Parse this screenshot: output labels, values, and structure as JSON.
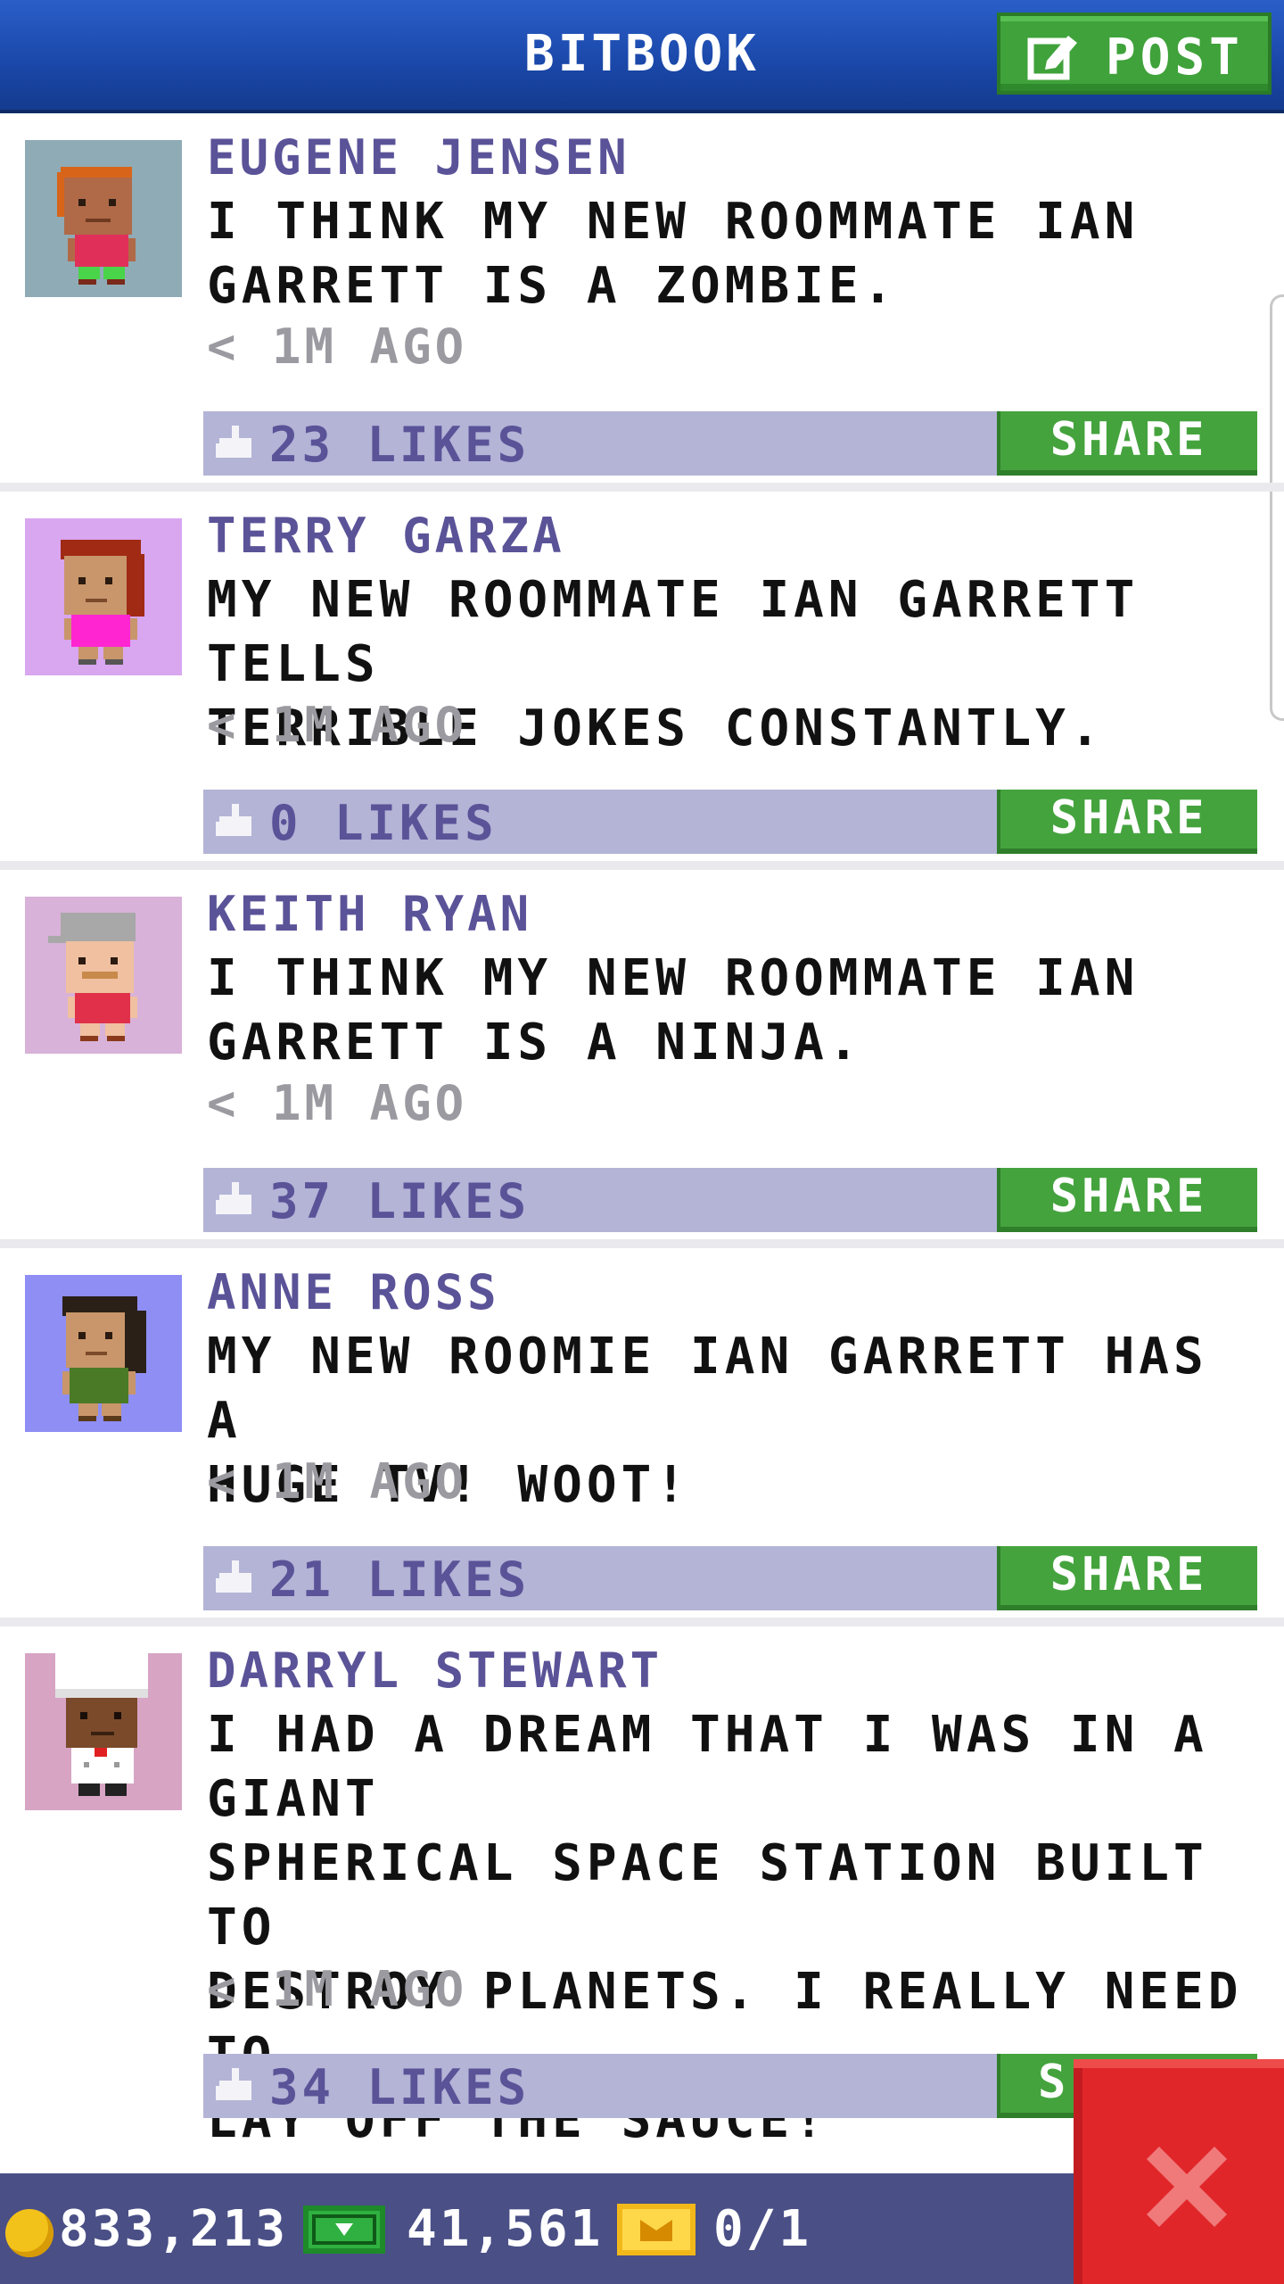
{
  "header": {
    "title": "BITBOOK",
    "post_label": "POST"
  },
  "posts": [
    {
      "author": "EUGENE JENSEN",
      "text": "I THINK MY NEW ROOMMATE IAN\nGARRETT IS A ZOMBIE.",
      "time": "< 1M AGO",
      "likes": "23 LIKES",
      "share_label": "SHARE",
      "avatar_bg": "#8fabb5"
    },
    {
      "author": "TERRY GARZA",
      "text": "MY NEW ROOMMATE IAN GARRETT TELLS\nTERRIBLE JOKES CONSTANTLY.",
      "time": "< 1M AGO",
      "likes": "0 LIKES",
      "share_label": "SHARE",
      "avatar_bg": "#d9a6f0"
    },
    {
      "author": "KEITH RYAN",
      "text": "I THINK MY NEW ROOMMATE IAN\nGARRETT IS A NINJA.",
      "time": "< 1M AGO",
      "likes": "37 LIKES",
      "share_label": "SHARE",
      "avatar_bg": "#d8b2d8"
    },
    {
      "author": "ANNE ROSS",
      "text": "MY NEW ROOMIE IAN GARRETT HAS A\nHUGE TV! WOOT!",
      "time": "< 1M AGO",
      "likes": "21 LIKES",
      "share_label": "SHARE",
      "avatar_bg": "#8e8ef4"
    },
    {
      "author": "DARRYL STEWART",
      "text": "I HAD A DREAM THAT I WAS IN A GIANT\nSPHERICAL SPACE STATION BUILT TO\nDESTROY PLANETS. I REALLY NEED TO\nLAY OFF THE SAUCE!",
      "time": "< 1M AGO",
      "likes": "34 LIKES",
      "share_label": "S",
      "avatar_bg": "#d7a4c4"
    }
  ],
  "status": {
    "coins": "833,213",
    "bux": "41,561",
    "vip": "0/1"
  },
  "colors": {
    "header_blue": "#1a47a8",
    "share_green": "#45a33e",
    "like_bar": "#b3b4d6",
    "author_purple": "#5a5398",
    "close_red": "#e1262a",
    "status_bar": "#4a4f86"
  },
  "icons": [
    "edit-icon",
    "like-icon",
    "coin-icon",
    "bux-icon",
    "vip-ticket-icon",
    "close-icon"
  ]
}
